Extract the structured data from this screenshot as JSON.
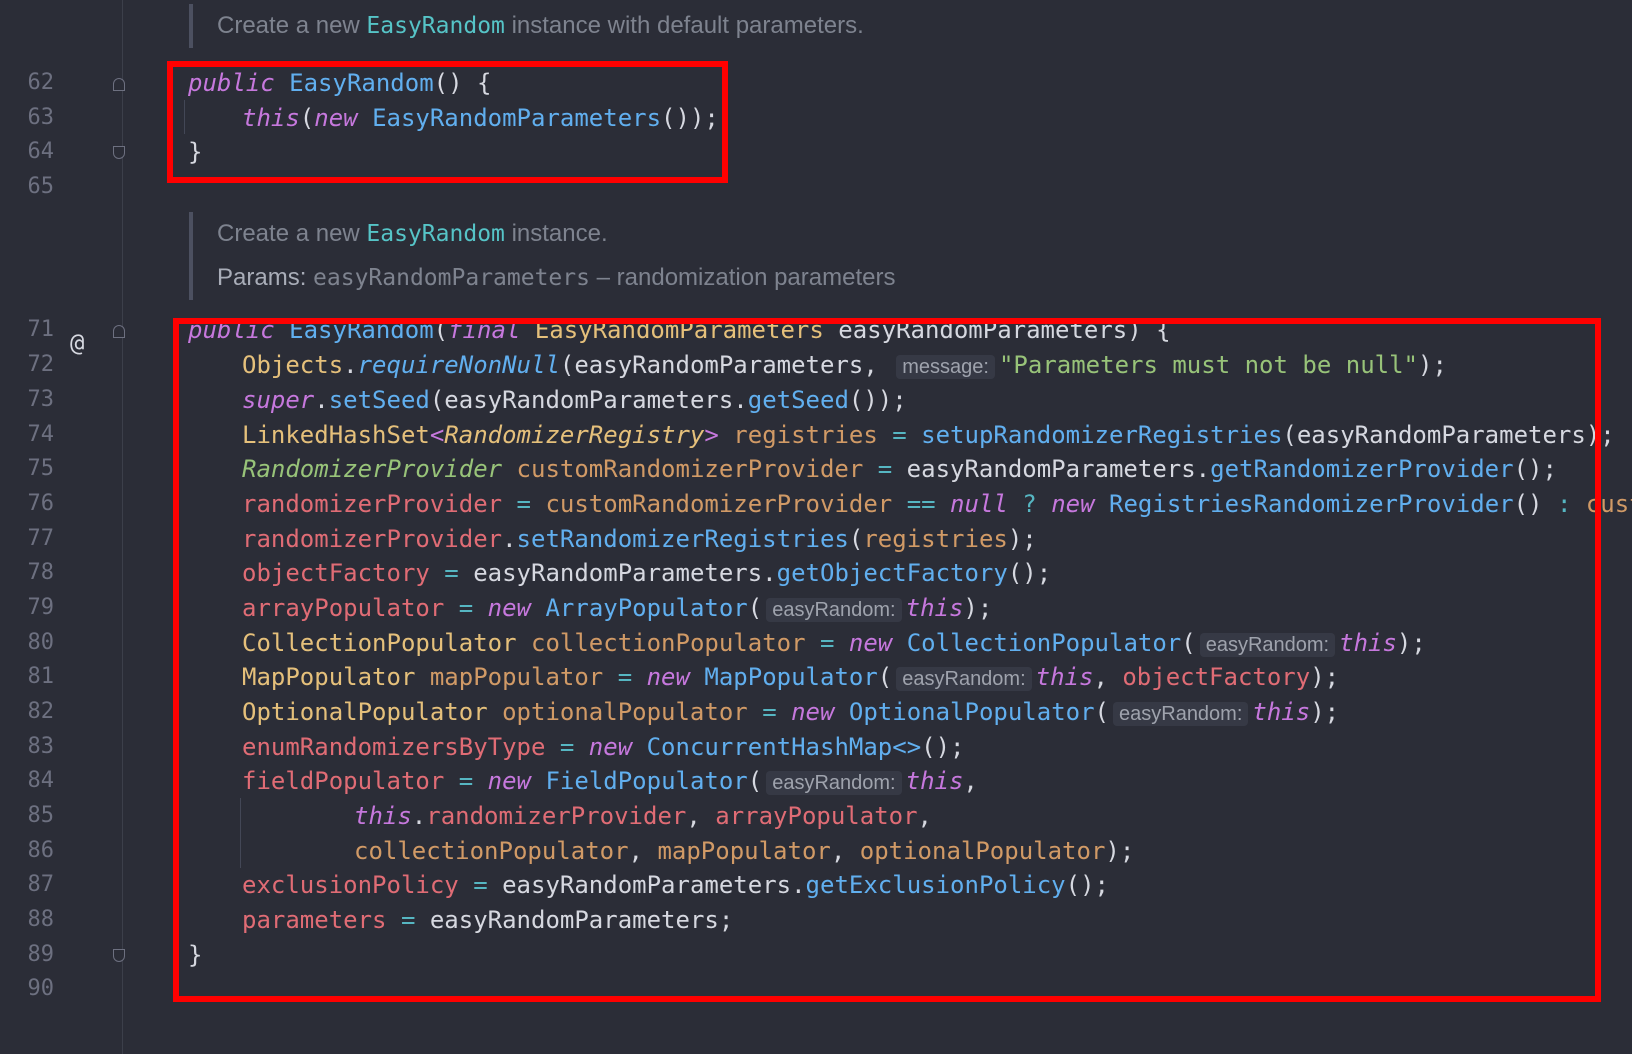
{
  "editor": {
    "doc_comment_1": {
      "prefix": "Create a new ",
      "code": "EasyRandom",
      "suffix": " instance with default parameters."
    },
    "doc_comment_2": {
      "prefix": "Create a new ",
      "code": "EasyRandom",
      "suffix": " instance.",
      "params_label": "Params: ",
      "param_name": "easyRandomParameters",
      "param_desc": " – randomization parameters"
    },
    "line_numbers": {
      "l62": "62",
      "l63": "63",
      "l64": "64",
      "l65": "65",
      "l71": "71",
      "l72": "72",
      "l73": "73",
      "l74": "74",
      "l75": "75",
      "l76": "76",
      "l77": "77",
      "l78": "78",
      "l79": "79",
      "l80": "80",
      "l81": "81",
      "l82": "82",
      "l83": "83",
      "l84": "84",
      "l85": "85",
      "l86": "86",
      "l87": "87",
      "l88": "88",
      "l89": "89",
      "l90": "90"
    },
    "gutter_icon_71": "@",
    "hints": {
      "message": "message:",
      "easyRandom": "easyRandom:"
    },
    "code": {
      "l62": [
        "public",
        " ",
        "EasyRandom",
        "() {"
      ],
      "l63": [
        "this",
        "(",
        "new",
        " ",
        "EasyRandomParameters",
        "());"
      ],
      "l64": [
        "}"
      ],
      "l71": [
        "public",
        " ",
        "EasyRandom",
        "(",
        "final",
        " ",
        "EasyRandomParameters",
        " easyRandomParameters) {"
      ],
      "l72": [
        "Objects",
        ".",
        "requireNonNull",
        "(easyRandomParameters, ",
        "\"Parameters must not be null\"",
        ");"
      ],
      "l73": [
        "super",
        ".",
        "setSeed",
        "(easyRandomParameters.",
        "getSeed",
        "());"
      ],
      "l74": [
        "LinkedHashSet",
        "<",
        "RandomizerRegistry",
        ">",
        " ",
        "registries",
        " ",
        "=",
        " ",
        "setupRandomizerRegistries",
        "(easyRandomParameters);"
      ],
      "l75": [
        "RandomizerProvider",
        " ",
        "customRandomizerProvider",
        " ",
        "=",
        " easyRandomParameters.",
        "getRandomizerProvider",
        "();"
      ],
      "l76": [
        "randomizerProvider",
        " ",
        "=",
        " ",
        "customRandomizerProvider",
        " ",
        "==",
        " ",
        "null",
        " ",
        "?",
        " ",
        "new",
        " ",
        "RegistriesRandomizerProvider",
        "() ",
        ":",
        " ",
        "customR"
      ],
      "l77": [
        "randomizerProvider",
        ".",
        "setRandomizerRegistries",
        "(",
        "registries",
        ");"
      ],
      "l78": [
        "objectFactory",
        " ",
        "=",
        " easyRandomParameters.",
        "getObjectFactory",
        "();"
      ],
      "l79": [
        "arrayPopulator",
        " ",
        "=",
        " ",
        "new",
        " ",
        "ArrayPopulator",
        "(",
        "this",
        ");"
      ],
      "l80": [
        "CollectionPopulator",
        " ",
        "collectionPopulator",
        " ",
        "=",
        " ",
        "new",
        " ",
        "CollectionPopulator",
        "(",
        "this",
        ");"
      ],
      "l81": [
        "MapPopulator",
        " ",
        "mapPopulator",
        " ",
        "=",
        " ",
        "new",
        " ",
        "MapPopulator",
        "(",
        "this",
        ", ",
        "objectFactory",
        ");"
      ],
      "l82": [
        "OptionalPopulator",
        " ",
        "optionalPopulator",
        " ",
        "=",
        " ",
        "new",
        " ",
        "OptionalPopulator",
        "(",
        "this",
        ");"
      ],
      "l83": [
        "enumRandomizersByType",
        " ",
        "=",
        " ",
        "new",
        " ",
        "ConcurrentHashMap<>",
        "();"
      ],
      "l84": [
        "fieldPopulator",
        " ",
        "=",
        " ",
        "new",
        " ",
        "FieldPopulator",
        "(",
        "this",
        ","
      ],
      "l85": [
        "this",
        ".",
        "randomizerProvider",
        ", ",
        "arrayPopulator",
        ","
      ],
      "l86": [
        "collectionPopulator",
        ", ",
        "mapPopulator",
        ", ",
        "optionalPopulator",
        ");"
      ],
      "l87": [
        "exclusionPolicy",
        " ",
        "=",
        " easyRandomParameters.",
        "getExclusionPolicy",
        "();"
      ],
      "l88": [
        "parameters",
        " ",
        "=",
        " easyRandomParameters;"
      ],
      "l89": [
        "}"
      ]
    },
    "colors": {
      "background": "#2b2d37",
      "keyword": "#c678dd",
      "function": "#61afef",
      "type": "#e5c07b",
      "field": "#e06c75",
      "local": "#d19a66",
      "string": "#98c379",
      "highlight_box": "#ff0000"
    }
  }
}
